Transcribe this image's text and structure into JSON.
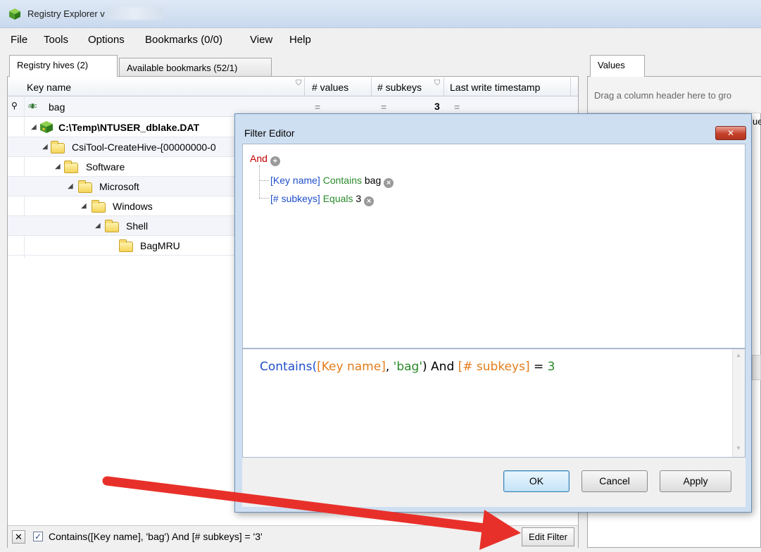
{
  "window": {
    "title": "Registry Explorer v"
  },
  "menu": [
    "File",
    "Tools",
    "Options",
    "Bookmarks (0/0)",
    "View",
    "Help"
  ],
  "tabs": {
    "registry_hives": "Registry hives (2)",
    "available_bookmarks": "Available bookmarks (52/1)",
    "values": "Values"
  },
  "grid": {
    "columns": [
      "Key name",
      "# values",
      "# subkeys",
      "Last write timestamp"
    ],
    "filter_row": {
      "key_name": "bag",
      "values_op": "=",
      "subkeys_op": "=",
      "subkeys_value": "3",
      "timestamp_op": "="
    },
    "rows": [
      {
        "label": "C:\\Temp\\NTUSER_dblake.DAT"
      },
      {
        "label": "CsiTool-CreateHive-{00000000-0"
      },
      {
        "label": "Software"
      },
      {
        "label": "Microsoft"
      },
      {
        "label": "Windows"
      },
      {
        "label": "Shell"
      },
      {
        "label": "BagMRU"
      }
    ]
  },
  "right_panel": {
    "group_hint": "Drag a column header here to gro",
    "partial_header": "ue"
  },
  "bottom_bar": {
    "close_label": "✕",
    "filter_text": "Contains([Key name], 'bag') And [# subkeys] = '3'",
    "edit_filter": "Edit Filter"
  },
  "dialog": {
    "title": "Filter Editor",
    "close_label": "✕",
    "root_op": "And",
    "conditions": [
      {
        "field": "[Key name]",
        "op": "Contains",
        "value": "bag"
      },
      {
        "field": "[# subkeys]",
        "op": "Equals",
        "value": "3"
      }
    ],
    "expression": {
      "func": "Contains(",
      "field1": "[Key name]",
      "sep": ", ",
      "str": "'bag'",
      "close": ") And ",
      "field2": "[# subkeys]",
      "eq": " = ",
      "num": "3"
    },
    "buttons": {
      "ok": "OK",
      "cancel": "Cancel",
      "apply": "Apply"
    }
  },
  "colors": {
    "accent_red": "#e8302a",
    "title_bar": "#c9d9ee",
    "dialog_frame": "#cfdff2"
  }
}
